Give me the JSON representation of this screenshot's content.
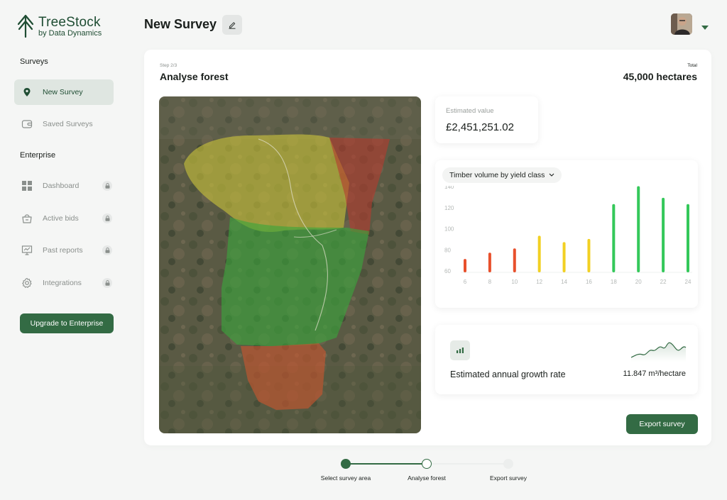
{
  "brand": {
    "name": "TreeStock",
    "tagline": "by Data Dynamics"
  },
  "sidebar": {
    "surveys_label": "Surveys",
    "enterprise_label": "Enterprise",
    "items": [
      {
        "label": "New Survey",
        "icon": "map-pin-icon",
        "active": true,
        "locked": false
      },
      {
        "label": "Saved Surveys",
        "icon": "wallet-icon",
        "active": false,
        "locked": false
      },
      {
        "label": "Dashboard",
        "icon": "grid-icon",
        "active": false,
        "locked": true
      },
      {
        "label": "Active bids",
        "icon": "basket-icon",
        "active": false,
        "locked": true
      },
      {
        "label": "Past reports",
        "icon": "presentation-icon",
        "active": false,
        "locked": true
      },
      {
        "label": "Integrations",
        "icon": "gear-icon",
        "active": false,
        "locked": true
      }
    ],
    "upgrade_label": "Upgrade to Enterprise"
  },
  "header": {
    "title": "New Survey"
  },
  "main": {
    "step_label": "Step 2/3",
    "step_title": "Analyse forest",
    "total_label": "Total",
    "total_value": "45,000 hectares",
    "estimated_value_label": "Estimated value",
    "estimated_value": "£2,451,251.02",
    "chart_select_label": "Timber volume by yield class",
    "growth_title": "Estimated annual growth rate",
    "growth_value": "11.847 m³/hectare",
    "export_label": "Export survey"
  },
  "stepper": {
    "steps": [
      {
        "label": "Select survey area",
        "state": "done"
      },
      {
        "label": "Analyse forest",
        "state": "current"
      },
      {
        "label": "Export survey",
        "state": "pending"
      }
    ]
  },
  "colors": {
    "brand_green": "#336b44",
    "bar_red": "#e8502c",
    "bar_yellow": "#f2d022",
    "bar_green": "#34c85a"
  },
  "chart_data": {
    "type": "bar",
    "title": "Timber volume by yield class",
    "categories": [
      "6",
      "8",
      "10",
      "12",
      "14",
      "16",
      "18",
      "20",
      "22",
      "24"
    ],
    "values": [
      70,
      76,
      80,
      92,
      86,
      89,
      122,
      139,
      128,
      122
    ],
    "bar_colors": [
      "red",
      "red",
      "red",
      "yellow",
      "yellow",
      "yellow",
      "green",
      "green",
      "green",
      "green"
    ],
    "ylim": [
      60,
      140
    ],
    "yticks": [
      60,
      80,
      100,
      120,
      140
    ],
    "xlabel": "",
    "ylabel": "",
    "grid": false
  }
}
